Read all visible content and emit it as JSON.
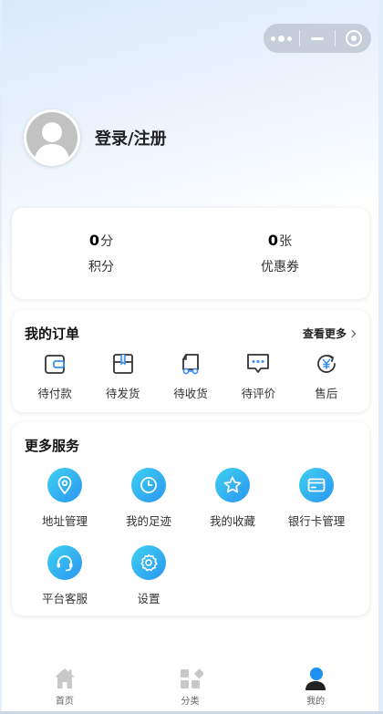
{
  "profile": {
    "login_label": "登录/注册"
  },
  "points": [
    {
      "value": "0",
      "unit": "分",
      "label": "积分"
    },
    {
      "value": "0",
      "unit": "张",
      "label": "优惠券"
    }
  ],
  "orders": {
    "title": "我的订单",
    "more_label": "查看更多",
    "items": [
      {
        "label": "待付款",
        "icon": "wallet-icon"
      },
      {
        "label": "待发货",
        "icon": "package-icon"
      },
      {
        "label": "待收货",
        "icon": "truck-icon"
      },
      {
        "label": "待评价",
        "icon": "comment-icon"
      },
      {
        "label": "售后",
        "icon": "yen-refund-icon"
      }
    ]
  },
  "services": {
    "title": "更多服务",
    "items": [
      {
        "label": "地址管理",
        "icon": "location-icon"
      },
      {
        "label": "我的足迹",
        "icon": "clock-icon"
      },
      {
        "label": "我的收藏",
        "icon": "star-icon"
      },
      {
        "label": "银行卡管理",
        "icon": "bank-card-icon"
      },
      {
        "label": "平台客服",
        "icon": "headset-icon"
      },
      {
        "label": "设置",
        "icon": "gear-icon"
      }
    ]
  },
  "tabbar": [
    {
      "label": "首页",
      "icon": "home-icon",
      "active": false
    },
    {
      "label": "分类",
      "icon": "category-icon",
      "active": false
    },
    {
      "label": "我的",
      "icon": "user-icon",
      "active": true
    }
  ],
  "colors": {
    "accent": "#2a96f2",
    "accent_light": "#3fd0ef",
    "inactive_icon": "#c8c8c8"
  }
}
